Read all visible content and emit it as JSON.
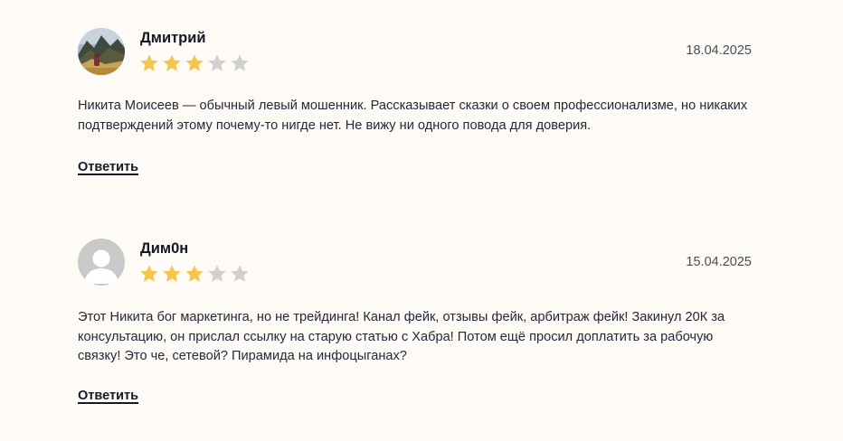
{
  "colors": {
    "background": "#fefaf6",
    "star_filled": "#f5c64d",
    "star_empty": "#d0d0d0"
  },
  "comments": [
    {
      "author": "Дмитрий",
      "avatar": "mountain-photo-avatar",
      "rating": 3,
      "max_rating": 5,
      "date": "18.04.2025",
      "text": "Никита Моисеев — обычный левый мошенник. Рассказывает сказки о своем профессионализме, но никаких подтверждений этому почему-то нигде нет. Не вижу ни одного повода для доверия.",
      "reply_label": "Ответить"
    },
    {
      "author": "Дим0н",
      "avatar": "default-user-avatar",
      "rating": 3,
      "max_rating": 5,
      "date": "15.04.2025",
      "text": "Этот Никита бог маркетинга, но не трейдинга! Канал фейк, отзывы фейк, арбитраж фейк! Закинул 20К за консультацию, он прислал ссылку на старую статью с Хабра! Потом ещё просил доплатить за рабочую связку! Это че, сетевой? Пирамида на инфоцыганах?",
      "reply_label": "Ответить"
    }
  ]
}
